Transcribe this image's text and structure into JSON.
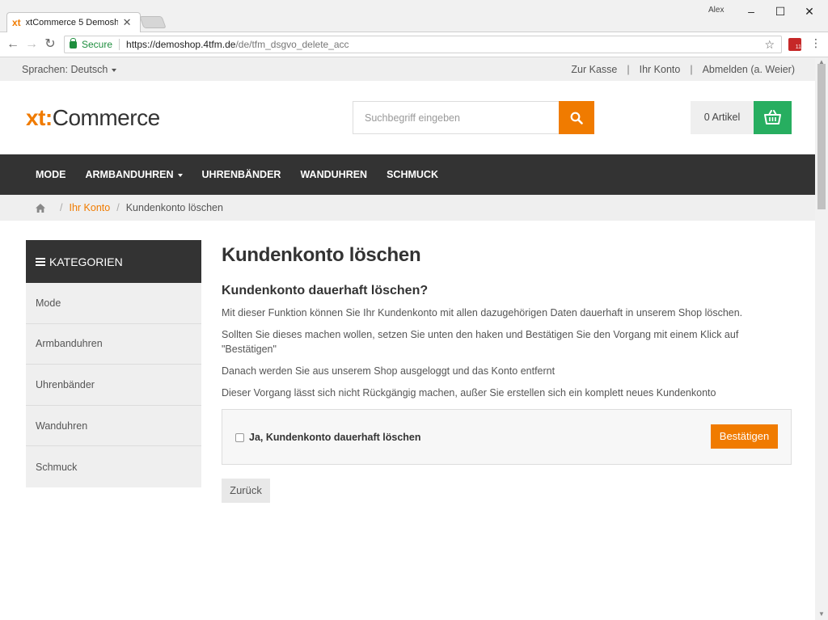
{
  "browser": {
    "tab_logo": "xt",
    "tab_title": "xtCommerce 5 Demosho",
    "tab_close": "✕",
    "user": "Alex",
    "url_secure": "Secure",
    "url_host": "https://demoshop.4tfm.de",
    "url_path": "/de/tfm_dsgvo_delete_acc",
    "ext_badge": "11"
  },
  "topbar": {
    "language": "Sprachen: Deutsch",
    "links": [
      "Zur Kasse",
      "Ihr Konto",
      "Abmelden (a. Weier)"
    ]
  },
  "header": {
    "logo_xt": "xt:",
    "logo_commerce": "Commerce",
    "search_placeholder": "Suchbegriff eingeben",
    "cart_count": "0 Artikel"
  },
  "mainnav": [
    "MODE",
    "ARMBANDUHREN",
    "UHRENBÄNDER",
    "WANDUHREN",
    "SCHMUCK"
  ],
  "breadcrumb": {
    "link": "Ihr Konto",
    "current": "Kundenkonto löschen",
    "sep": "/"
  },
  "sidebar": {
    "title": "KATEGORIEN",
    "items": [
      "Mode",
      "Armbanduhren",
      "Uhrenbänder",
      "Wanduhren",
      "Schmuck"
    ]
  },
  "content": {
    "title": "Kundenkonto löschen",
    "subtitle": "Kundenkonto dauerhaft löschen?",
    "paragraphs": [
      "Mit dieser Funktion können Sie Ihr Kundenkonto mit allen dazugehörigen Daten dauerhaft in unserem Shop löschen.",
      "Sollten Sie dieses machen wollen, setzen Sie unten den haken und Bestätigen Sie den Vorgang mit einem Klick auf \"Bestätigen\"",
      "Danach werden Sie aus unserem Shop ausgeloggt und das Konto entfernt",
      "Dieser Vorgang lässt sich nicht Rückgängig machen, außer Sie erstellen sich ein komplett neues Kundenkonto"
    ],
    "checkbox_label": "Ja, Kundenkonto dauerhaft löschen",
    "confirm_label": "Bestätigen",
    "back_label": "Zurück"
  },
  "colors": {
    "accent": "#f07b00",
    "cart_green": "#27ae60",
    "nav_dark": "#333333"
  }
}
